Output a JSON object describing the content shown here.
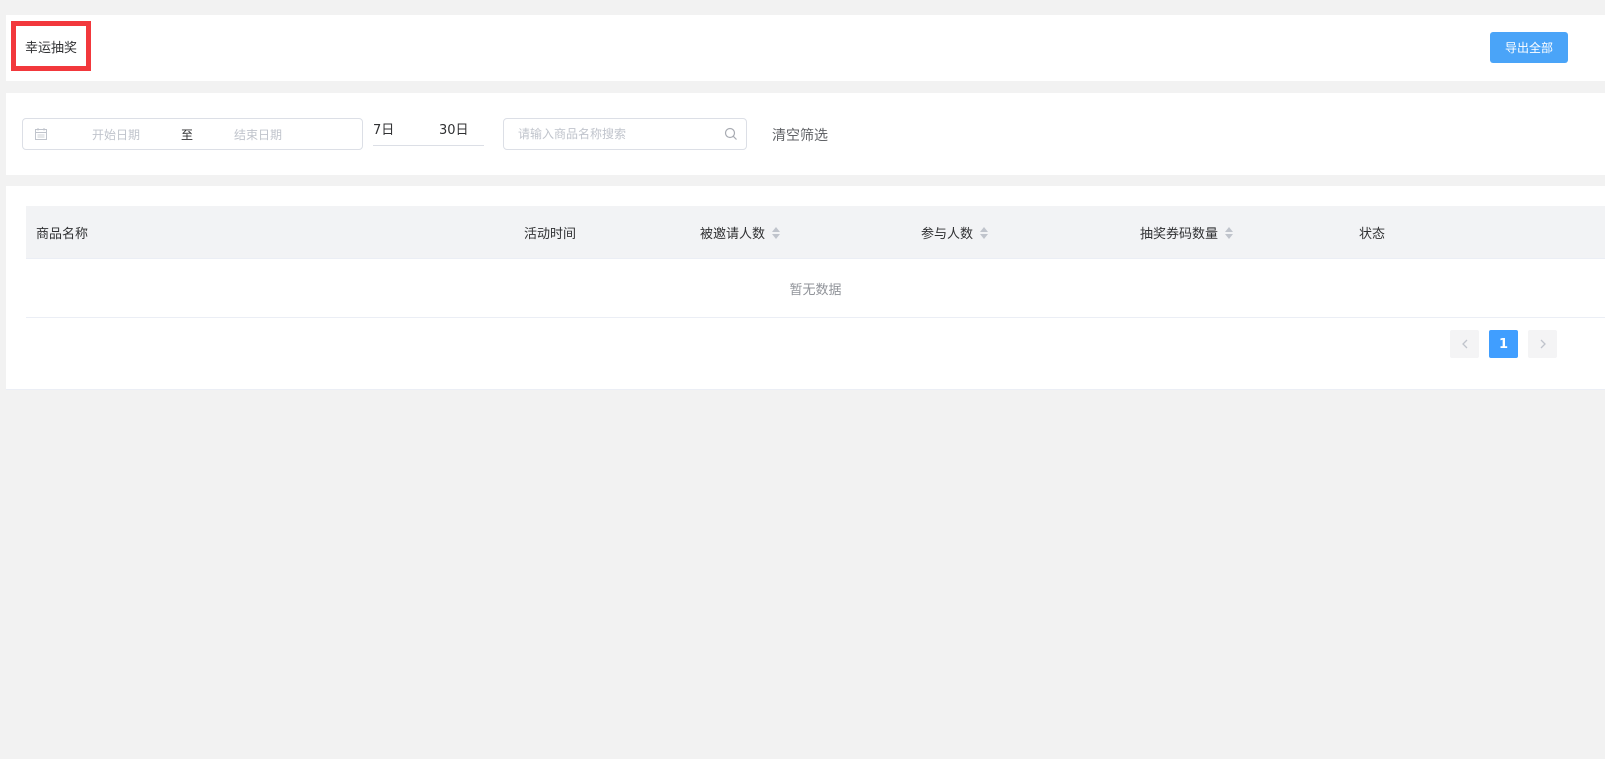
{
  "header": {
    "title": "幸运抽奖",
    "export_label": "导出全部"
  },
  "filters": {
    "start_date_placeholder": "开始日期",
    "range_separator": "至",
    "end_date_placeholder": "结束日期",
    "quick_7": "7日",
    "quick_30": "30日",
    "search_placeholder": "请输入商品名称搜索",
    "clear_label": "清空筛选"
  },
  "table": {
    "columns": [
      "商品名称",
      "活动时间",
      "被邀请人数",
      "参与人数",
      "抽奖券码数量",
      "状态"
    ],
    "empty_text": "暂无数据"
  },
  "pagination": {
    "current_page": "1"
  },
  "colors": {
    "accent": "#409eff",
    "export_button": "#4aa4f8",
    "highlight_border": "#f2383c"
  }
}
